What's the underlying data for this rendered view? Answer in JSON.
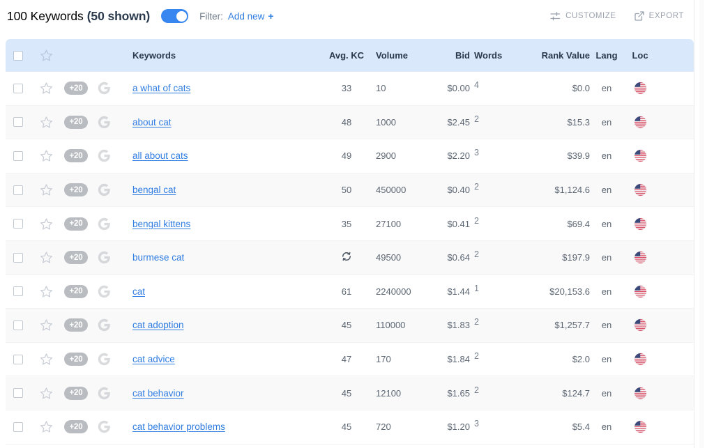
{
  "toolbar": {
    "count_label": "100 Keywords",
    "shown_label": "(50 shown)",
    "filter_label": "Filter:",
    "add_new_label": "Add new",
    "add_new_plus": "+",
    "customize_label": "CUSTOMIZE",
    "export_label": "EXPORT",
    "toggle_state": "on",
    "accent_color": "#2f7de1",
    "toggle_color": "#3886f0"
  },
  "table": {
    "header_bg": "#d9e8fb",
    "columns": [
      {
        "key": "checkbox",
        "label": ""
      },
      {
        "key": "star",
        "label": ""
      },
      {
        "key": "badge",
        "label": ""
      },
      {
        "key": "engine",
        "label": ""
      },
      {
        "key": "keywords",
        "label": "Keywords"
      },
      {
        "key": "avg_kc",
        "label": "Avg. KC"
      },
      {
        "key": "volume",
        "label": "Volume"
      },
      {
        "key": "bid",
        "label": "Bid"
      },
      {
        "key": "words",
        "label": "Words"
      },
      {
        "key": "rank_value",
        "label": "Rank Value"
      },
      {
        "key": "lang",
        "label": "Lang"
      },
      {
        "key": "loc",
        "label": "Loc"
      }
    ],
    "rows": [
      {
        "badge": "+20",
        "keyword": "a what of cats",
        "avg_kc": "33",
        "volume": "10",
        "bid": "$0.00",
        "words": "4",
        "rank_value": "$0.0",
        "lang": "en",
        "loc": "us",
        "underline": true,
        "loading": false
      },
      {
        "badge": "+20",
        "keyword": "about cat",
        "avg_kc": "48",
        "volume": "1000",
        "bid": "$2.45",
        "words": "2",
        "rank_value": "$15.3",
        "lang": "en",
        "loc": "us",
        "underline": true,
        "loading": false
      },
      {
        "badge": "+20",
        "keyword": "all about cats",
        "avg_kc": "49",
        "volume": "2900",
        "bid": "$2.20",
        "words": "3",
        "rank_value": "$39.9",
        "lang": "en",
        "loc": "us",
        "underline": true,
        "loading": false
      },
      {
        "badge": "+20",
        "keyword": "bengal cat",
        "avg_kc": "50",
        "volume": "450000",
        "bid": "$0.40",
        "words": "2",
        "rank_value": "$1,124.6",
        "lang": "en",
        "loc": "us",
        "underline": true,
        "loading": false
      },
      {
        "badge": "+20",
        "keyword": "bengal kittens",
        "avg_kc": "35",
        "volume": "27100",
        "bid": "$0.41",
        "words": "2",
        "rank_value": "$69.4",
        "lang": "en",
        "loc": "us",
        "underline": true,
        "loading": false
      },
      {
        "badge": "+20",
        "keyword": "burmese cat",
        "avg_kc": "",
        "volume": "49500",
        "bid": "$0.64",
        "words": "2",
        "rank_value": "$197.9",
        "lang": "en",
        "loc": "us",
        "underline": false,
        "loading": true
      },
      {
        "badge": "+20",
        "keyword": "cat",
        "avg_kc": "61",
        "volume": "2240000",
        "bid": "$1.44",
        "words": "1",
        "rank_value": "$20,153.6",
        "lang": "en",
        "loc": "us",
        "underline": true,
        "loading": false
      },
      {
        "badge": "+20",
        "keyword": "cat adoption",
        "avg_kc": "45",
        "volume": "110000",
        "bid": "$1.83",
        "words": "2",
        "rank_value": "$1,257.7",
        "lang": "en",
        "loc": "us",
        "underline": true,
        "loading": false
      },
      {
        "badge": "+20",
        "keyword": "cat advice",
        "avg_kc": "47",
        "volume": "170",
        "bid": "$1.84",
        "words": "2",
        "rank_value": "$2.0",
        "lang": "en",
        "loc": "us",
        "underline": true,
        "loading": false
      },
      {
        "badge": "+20",
        "keyword": "cat behavior",
        "avg_kc": "45",
        "volume": "12100",
        "bid": "$1.65",
        "words": "2",
        "rank_value": "$124.7",
        "lang": "en",
        "loc": "us",
        "underline": true,
        "loading": false
      },
      {
        "badge": "+20",
        "keyword": "cat behavior problems",
        "avg_kc": "45",
        "volume": "720",
        "bid": "$1.20",
        "words": "3",
        "rank_value": "$5.4",
        "lang": "en",
        "loc": "us",
        "underline": true,
        "loading": false
      }
    ]
  }
}
